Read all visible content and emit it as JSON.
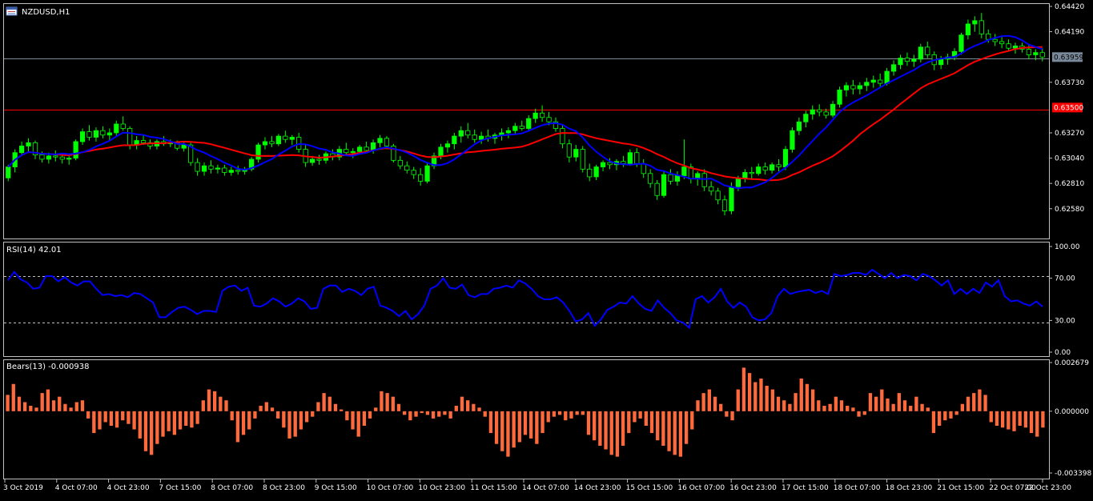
{
  "main_panel": {
    "symbol_label": "NZDUSD,H1",
    "price_ticks": [
      "0.64420",
      "0.64190",
      "0.63730",
      "0.63270",
      "0.63040",
      "0.62810",
      "0.62580"
    ],
    "current_price_label": "0.63959",
    "red_level_label": "0.63500",
    "current_price": 0.63959,
    "red_level": 0.635,
    "y_top": 0.6442,
    "y_bottom": 0.6244,
    "ma_fast_color": "#0000ff",
    "ma_slow_color": "#ff0000",
    "candle_color": "#00ff00",
    "candles_ohlc": [
      [
        0.6286,
        0.6298,
        0.6283,
        0.6296
      ],
      [
        0.6296,
        0.6312,
        0.6291,
        0.6309
      ],
      [
        0.6309,
        0.6319,
        0.6306,
        0.6315
      ],
      [
        0.6315,
        0.6322,
        0.631,
        0.6318
      ],
      [
        0.6318,
        0.632,
        0.6303,
        0.6307
      ],
      [
        0.6307,
        0.631,
        0.63,
        0.6303
      ],
      [
        0.6303,
        0.6309,
        0.6299,
        0.6306
      ],
      [
        0.6306,
        0.6311,
        0.6301,
        0.6305
      ],
      [
        0.6305,
        0.6308,
        0.6299,
        0.6303
      ],
      [
        0.6303,
        0.6307,
        0.6298,
        0.6304
      ],
      [
        0.6304,
        0.6321,
        0.6302,
        0.6319
      ],
      [
        0.6319,
        0.6331,
        0.6316,
        0.6328
      ],
      [
        0.6328,
        0.6334,
        0.632,
        0.6323
      ],
      [
        0.6323,
        0.6332,
        0.6319,
        0.6329
      ],
      [
        0.6329,
        0.6333,
        0.6322,
        0.6325
      ],
      [
        0.6325,
        0.6331,
        0.632,
        0.6327
      ],
      [
        0.6327,
        0.6338,
        0.6324,
        0.6335
      ],
      [
        0.6335,
        0.6342,
        0.6329,
        0.6331
      ],
      [
        0.6331,
        0.6333,
        0.6312,
        0.6316
      ],
      [
        0.6316,
        0.6324,
        0.6312,
        0.632
      ],
      [
        0.632,
        0.6325,
        0.6316,
        0.6318
      ],
      [
        0.6318,
        0.6321,
        0.6312,
        0.6315
      ],
      [
        0.6315,
        0.6321,
        0.6312,
        0.6319
      ],
      [
        0.6319,
        0.6324,
        0.6315,
        0.6317
      ],
      [
        0.6317,
        0.6321,
        0.6314,
        0.6318
      ],
      [
        0.6318,
        0.632,
        0.6311,
        0.6313
      ],
      [
        0.6313,
        0.6319,
        0.631,
        0.6316
      ],
      [
        0.6316,
        0.6318,
        0.6297,
        0.63
      ],
      [
        0.63,
        0.6304,
        0.6288,
        0.6292
      ],
      [
        0.6292,
        0.63,
        0.6288,
        0.6297
      ],
      [
        0.6297,
        0.6302,
        0.629,
        0.6294
      ],
      [
        0.6294,
        0.6298,
        0.629,
        0.6295
      ],
      [
        0.6295,
        0.6298,
        0.6288,
        0.6291
      ],
      [
        0.6291,
        0.6296,
        0.6288,
        0.6293
      ],
      [
        0.6293,
        0.6297,
        0.6289,
        0.6292
      ],
      [
        0.6292,
        0.6296,
        0.6289,
        0.6294
      ],
      [
        0.6294,
        0.6305,
        0.6292,
        0.6303
      ],
      [
        0.6303,
        0.6318,
        0.63,
        0.6316
      ],
      [
        0.6316,
        0.6323,
        0.6312,
        0.6319
      ],
      [
        0.6319,
        0.6324,
        0.6314,
        0.6317
      ],
      [
        0.6317,
        0.6326,
        0.6315,
        0.6324
      ],
      [
        0.6324,
        0.6329,
        0.6318,
        0.6321
      ],
      [
        0.6321,
        0.6325,
        0.6316,
        0.6323
      ],
      [
        0.6323,
        0.6327,
        0.6309,
        0.6312
      ],
      [
        0.6312,
        0.6316,
        0.6296,
        0.63
      ],
      [
        0.63,
        0.6306,
        0.6297,
        0.6303
      ],
      [
        0.6303,
        0.6307,
        0.6298,
        0.6302
      ],
      [
        0.6302,
        0.631,
        0.6299,
        0.6308
      ],
      [
        0.6308,
        0.6312,
        0.6302,
        0.6305
      ],
      [
        0.6305,
        0.6315,
        0.6302,
        0.6312
      ],
      [
        0.6312,
        0.6318,
        0.6306,
        0.6309
      ],
      [
        0.6309,
        0.6313,
        0.6304,
        0.631
      ],
      [
        0.631,
        0.6316,
        0.6307,
        0.6314
      ],
      [
        0.6314,
        0.6319,
        0.6309,
        0.6311
      ],
      [
        0.6311,
        0.6321,
        0.6308,
        0.6318
      ],
      [
        0.6318,
        0.6325,
        0.6314,
        0.6322
      ],
      [
        0.6322,
        0.6324,
        0.6312,
        0.6315
      ],
      [
        0.6315,
        0.6317,
        0.63,
        0.6302
      ],
      [
        0.6302,
        0.6306,
        0.6294,
        0.6297
      ],
      [
        0.6297,
        0.6301,
        0.629,
        0.6293
      ],
      [
        0.6293,
        0.6296,
        0.6285,
        0.6289
      ],
      [
        0.6289,
        0.6295,
        0.6279,
        0.6283
      ],
      [
        0.6283,
        0.63,
        0.6281,
        0.6297
      ],
      [
        0.6297,
        0.6309,
        0.6294,
        0.6306
      ],
      [
        0.6306,
        0.6317,
        0.6303,
        0.6314
      ],
      [
        0.6314,
        0.632,
        0.6309,
        0.6317
      ],
      [
        0.6317,
        0.6327,
        0.6312,
        0.6324
      ],
      [
        0.6324,
        0.6333,
        0.6318,
        0.6329
      ],
      [
        0.6329,
        0.6336,
        0.6322,
        0.6325
      ],
      [
        0.6325,
        0.633,
        0.6318,
        0.6321
      ],
      [
        0.6321,
        0.6328,
        0.6317,
        0.6324
      ],
      [
        0.6324,
        0.633,
        0.6319,
        0.6322
      ],
      [
        0.6322,
        0.6327,
        0.6317,
        0.6325
      ],
      [
        0.6325,
        0.6331,
        0.632,
        0.6327
      ],
      [
        0.6327,
        0.6332,
        0.6322,
        0.6329
      ],
      [
        0.6329,
        0.6336,
        0.6326,
        0.6333
      ],
      [
        0.6333,
        0.6338,
        0.6329,
        0.6331
      ],
      [
        0.6331,
        0.6343,
        0.6328,
        0.634
      ],
      [
        0.634,
        0.6349,
        0.6336,
        0.6345
      ],
      [
        0.6345,
        0.6352,
        0.6337,
        0.6341
      ],
      [
        0.6341,
        0.6346,
        0.6334,
        0.6337
      ],
      [
        0.6337,
        0.6341,
        0.6328,
        0.6331
      ],
      [
        0.6331,
        0.6334,
        0.6313,
        0.6317
      ],
      [
        0.6317,
        0.6321,
        0.63,
        0.6305
      ],
      [
        0.6305,
        0.6316,
        0.6301,
        0.6312
      ],
      [
        0.6312,
        0.6315,
        0.6291,
        0.6294
      ],
      [
        0.6294,
        0.6299,
        0.6283,
        0.6287
      ],
      [
        0.6287,
        0.6298,
        0.6284,
        0.6296
      ],
      [
        0.6296,
        0.6302,
        0.6292,
        0.63
      ],
      [
        0.63,
        0.6304,
        0.6294,
        0.6298
      ],
      [
        0.6298,
        0.6303,
        0.6293,
        0.6301
      ],
      [
        0.6301,
        0.6306,
        0.6296,
        0.6299
      ],
      [
        0.6299,
        0.6312,
        0.6297,
        0.6309
      ],
      [
        0.6309,
        0.6313,
        0.6296,
        0.6299
      ],
      [
        0.6299,
        0.6303,
        0.6286,
        0.629
      ],
      [
        0.629,
        0.6294,
        0.6277,
        0.6281
      ],
      [
        0.6281,
        0.6284,
        0.6266,
        0.627
      ],
      [
        0.627,
        0.6292,
        0.6268,
        0.6289
      ],
      [
        0.6289,
        0.6294,
        0.628,
        0.6283
      ],
      [
        0.6283,
        0.6292,
        0.6279,
        0.6288
      ],
      [
        0.6288,
        0.6321,
        0.6285,
        0.6296
      ],
      [
        0.6296,
        0.6299,
        0.6281,
        0.6285
      ],
      [
        0.6285,
        0.6292,
        0.6279,
        0.629
      ],
      [
        0.629,
        0.6294,
        0.6274,
        0.6278
      ],
      [
        0.6278,
        0.6283,
        0.627,
        0.6274
      ],
      [
        0.6274,
        0.6277,
        0.6262,
        0.6266
      ],
      [
        0.6266,
        0.627,
        0.6252,
        0.6256
      ],
      [
        0.6256,
        0.6282,
        0.6253,
        0.6278
      ],
      [
        0.6278,
        0.6288,
        0.6274,
        0.6286
      ],
      [
        0.6286,
        0.6294,
        0.6282,
        0.6291
      ],
      [
        0.6291,
        0.6296,
        0.6285,
        0.629
      ],
      [
        0.629,
        0.6299,
        0.6288,
        0.6296
      ],
      [
        0.6296,
        0.63,
        0.6289,
        0.6293
      ],
      [
        0.6293,
        0.63,
        0.629,
        0.6298
      ],
      [
        0.6298,
        0.6303,
        0.6292,
        0.6296
      ],
      [
        0.6296,
        0.6315,
        0.6293,
        0.6312
      ],
      [
        0.6312,
        0.6332,
        0.6309,
        0.6329
      ],
      [
        0.6329,
        0.6341,
        0.6325,
        0.6337
      ],
      [
        0.6337,
        0.6347,
        0.6332,
        0.6344
      ],
      [
        0.6344,
        0.6352,
        0.6339,
        0.6348
      ],
      [
        0.6348,
        0.6353,
        0.6342,
        0.6346
      ],
      [
        0.6346,
        0.6349,
        0.634,
        0.6343
      ],
      [
        0.6343,
        0.6356,
        0.6341,
        0.6353
      ],
      [
        0.6353,
        0.6369,
        0.635,
        0.6366
      ],
      [
        0.6366,
        0.6373,
        0.636,
        0.637
      ],
      [
        0.637,
        0.6375,
        0.6362,
        0.6367
      ],
      [
        0.6367,
        0.6373,
        0.6362,
        0.637
      ],
      [
        0.637,
        0.6377,
        0.6365,
        0.6373
      ],
      [
        0.6373,
        0.6379,
        0.6368,
        0.6375
      ],
      [
        0.6375,
        0.6381,
        0.6369,
        0.6372
      ],
      [
        0.6372,
        0.6386,
        0.637,
        0.6383
      ],
      [
        0.6383,
        0.6393,
        0.6379,
        0.6389
      ],
      [
        0.6389,
        0.6398,
        0.6385,
        0.6395
      ],
      [
        0.6395,
        0.64,
        0.6388,
        0.6392
      ],
      [
        0.6392,
        0.6398,
        0.6387,
        0.6394
      ],
      [
        0.6394,
        0.6408,
        0.6391,
        0.6405
      ],
      [
        0.6405,
        0.641,
        0.6395,
        0.6398
      ],
      [
        0.6398,
        0.6401,
        0.6384,
        0.6389
      ],
      [
        0.6389,
        0.6397,
        0.6385,
        0.6394
      ],
      [
        0.6394,
        0.6399,
        0.6389,
        0.6396
      ],
      [
        0.6396,
        0.6404,
        0.6393,
        0.6401
      ],
      [
        0.6401,
        0.6418,
        0.6398,
        0.6416
      ],
      [
        0.6416,
        0.643,
        0.6412,
        0.6426
      ],
      [
        0.6426,
        0.6433,
        0.6419,
        0.6429
      ],
      [
        0.6429,
        0.6436,
        0.6413,
        0.6417
      ],
      [
        0.6417,
        0.6421,
        0.6409,
        0.6412
      ],
      [
        0.6412,
        0.6417,
        0.6406,
        0.641
      ],
      [
        0.641,
        0.6414,
        0.6404,
        0.6408
      ],
      [
        0.6408,
        0.6412,
        0.6401,
        0.6404
      ],
      [
        0.6404,
        0.6409,
        0.6399,
        0.6406
      ],
      [
        0.6406,
        0.6409,
        0.64,
        0.6403
      ],
      [
        0.6403,
        0.6407,
        0.6394,
        0.6398
      ],
      [
        0.6398,
        0.6403,
        0.6393,
        0.64
      ],
      [
        0.64,
        0.6404,
        0.6392,
        0.6396
      ]
    ]
  },
  "rsi_panel": {
    "label": "RSI(14) 42.01",
    "ticks": [
      "100.00",
      "70.00",
      "30.00",
      "0.00"
    ],
    "levels": [
      70,
      30
    ],
    "line_color": "#0000ff",
    "values": [
      68,
      76,
      69,
      66,
      60,
      61,
      72,
      72,
      67,
      71,
      66,
      63,
      67,
      67,
      60,
      54,
      55,
      53,
      54,
      52,
      56,
      55,
      51,
      47,
      33,
      33,
      38,
      42,
      43,
      40,
      36,
      39,
      39,
      38,
      58,
      62,
      63,
      58,
      61,
      44,
      43,
      46,
      51,
      48,
      43,
      46,
      51,
      48,
      41,
      42,
      60,
      63,
      63,
      57,
      60,
      58,
      54,
      60,
      62,
      44,
      42,
      39,
      34,
      39,
      31,
      36,
      44,
      60,
      63,
      70,
      61,
      60,
      64,
      54,
      52,
      55,
      55,
      60,
      61,
      63,
      61,
      68,
      65,
      60,
      53,
      50,
      50,
      52,
      47,
      39,
      29,
      31,
      37,
      25,
      31,
      40,
      43,
      47,
      46,
      53,
      46,
      41,
      39,
      49,
      42,
      37,
      30,
      28,
      23,
      50,
      53,
      47,
      52,
      60,
      48,
      42,
      47,
      43,
      33,
      30,
      31,
      37,
      53,
      60,
      55,
      57,
      58,
      59,
      56,
      58,
      55,
      74,
      72,
      73,
      75,
      75,
      73,
      78,
      74,
      70,
      75,
      70,
      73,
      72,
      68,
      74,
      72,
      68,
      63,
      68,
      55,
      60,
      55,
      60,
      56,
      66,
      62,
      68,
      53,
      48,
      49,
      46,
      44,
      48,
      43
    ]
  },
  "bears_panel": {
    "label": "Bears(13) -0.000938",
    "ticks": [
      "0.002679",
      "0.000000",
      "-0.003398"
    ],
    "y_top": 0.002679,
    "y_bottom": -0.003398,
    "bar_color": "#ff6a3c",
    "values": [
      0.0009,
      0.0015,
      0.0008,
      0.0005,
      0.0003,
      0.0002,
      0.001,
      0.0012,
      0.0006,
      0.0008,
      0.0004,
      0.0002,
      0.0005,
      0.0006,
      -0.0004,
      -0.0012,
      -0.001,
      -0.0006,
      -0.0008,
      -0.0009,
      -0.0005,
      -0.0007,
      -0.001,
      -0.0015,
      -0.0022,
      -0.0024,
      -0.0018,
      -0.0014,
      -0.0011,
      -0.0013,
      -0.001,
      -0.0008,
      -0.0009,
      -0.0007,
      0.0006,
      0.0012,
      0.0011,
      0.0008,
      0.0006,
      -0.0005,
      -0.0017,
      -0.0013,
      -0.001,
      -0.0004,
      0.0003,
      0.0005,
      0.0002,
      -0.0004,
      -0.0009,
      -0.0015,
      -0.0014,
      -0.001,
      -0.0006,
      -0.0003,
      0.0005,
      0.001,
      0.0008,
      0.0004,
      0.0001,
      -0.0005,
      -0.001,
      -0.0014,
      -0.0008,
      -0.0004,
      0.0002,
      0.0011,
      0.001,
      0.0008,
      0.0004,
      -0.0002,
      -0.0005,
      -0.0003,
      -0.0001,
      -0.0002,
      -0.0004,
      -0.0003,
      -0.0002,
      -0.0004,
      0.0003,
      0.0008,
      0.0006,
      0.0004,
      0.0002,
      -0.0003,
      -0.0012,
      -0.0018,
      -0.0022,
      -0.0025,
      -0.002,
      -0.0017,
      -0.0013,
      -0.0015,
      -0.0018,
      -0.0012,
      -0.0006,
      -0.0003,
      -0.0002,
      -0.0005,
      -0.0004,
      -0.0002,
      -0.0002,
      -0.0013,
      -0.0016,
      -0.0019,
      -0.0021,
      -0.0024,
      -0.0025,
      -0.0019,
      -0.0012,
      -0.0006,
      -0.0004,
      -0.0008,
      -0.0012,
      -0.0016,
      -0.0019,
      -0.0022,
      -0.0024,
      -0.0025,
      -0.0018,
      -0.001,
      0.0006,
      0.001,
      0.0012,
      0.0008,
      0.0004,
      -0.0003,
      -0.0005,
      0.0012,
      0.0024,
      0.0021,
      0.0016,
      0.0018,
      0.0014,
      0.0012,
      0.0008,
      0.0006,
      0.0004,
      0.001,
      0.0018,
      0.0015,
      0.0012,
      0.0006,
      0.0003,
      0.0004,
      0.0008,
      0.0006,
      0.0003,
      0.0002,
      -0.0003,
      -0.0002,
      0.001,
      0.0008,
      0.0012,
      0.0007,
      0.0004,
      0.001,
      0.0006,
      0.0003,
      0.0008,
      0.0004,
      0.0002,
      -0.0012,
      -0.0008,
      -0.0005,
      -0.0004,
      -0.0002,
      0.0004,
      0.0008,
      0.001,
      0.0012,
      0.0009,
      -0.0006,
      -0.0008,
      -0.0009,
      -0.001,
      -0.0011,
      -0.0008,
      -0.0009,
      -0.0012,
      -0.0014,
      -0.0009
    ]
  },
  "time_axis": {
    "labels": [
      "3 Oct 2019",
      "4 Oct 07:00",
      "4 Oct 23:00",
      "7 Oct 15:00",
      "8 Oct 07:00",
      "8 Oct 23:00",
      "9 Oct 15:00",
      "10 Oct 07:00",
      "10 Oct 23:00",
      "11 Oct 15:00",
      "14 Oct 07:00",
      "14 Oct 23:00",
      "15 Oct 15:00",
      "16 Oct 07:00",
      "16 Oct 23:00",
      "17 Oct 15:00",
      "18 Oct 07:00",
      "18 Oct 23:00",
      "21 Oct 15:00",
      "22 Oct 07:00",
      "22 Oct 23:00"
    ]
  },
  "colors": {
    "background": "#000000",
    "border": "#c0c0c0",
    "text": "#ffffff",
    "grid_level": "#c0c0c0",
    "current_price_line": "#7a8a9a",
    "red_level_line": "#ff0000"
  }
}
